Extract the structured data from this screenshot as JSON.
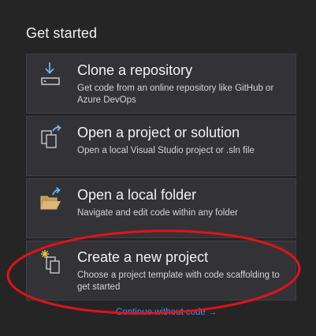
{
  "heading": "Get started",
  "cards": [
    {
      "title": "Clone a repository",
      "description": "Get code from an online repository like GitHub or Azure DevOps",
      "icon": "clone-download-icon"
    },
    {
      "title": "Open a project or solution",
      "description": "Open a local Visual Studio project or .sln file",
      "icon": "open-project-icon"
    },
    {
      "title": "Open a local folder",
      "description": "Navigate and edit code within any folder",
      "icon": "open-folder-icon"
    },
    {
      "title": "Create a new project",
      "description": "Choose a project template with code scaffolding to get started",
      "icon": "new-project-icon"
    }
  ],
  "continue_link": "Continue without code →",
  "colors": {
    "background": "#252526",
    "card": "#333337",
    "link": "#3794ff",
    "annotation": "#e0121a",
    "icon_blue": "#75beff",
    "icon_folder": "#dcb67a"
  }
}
